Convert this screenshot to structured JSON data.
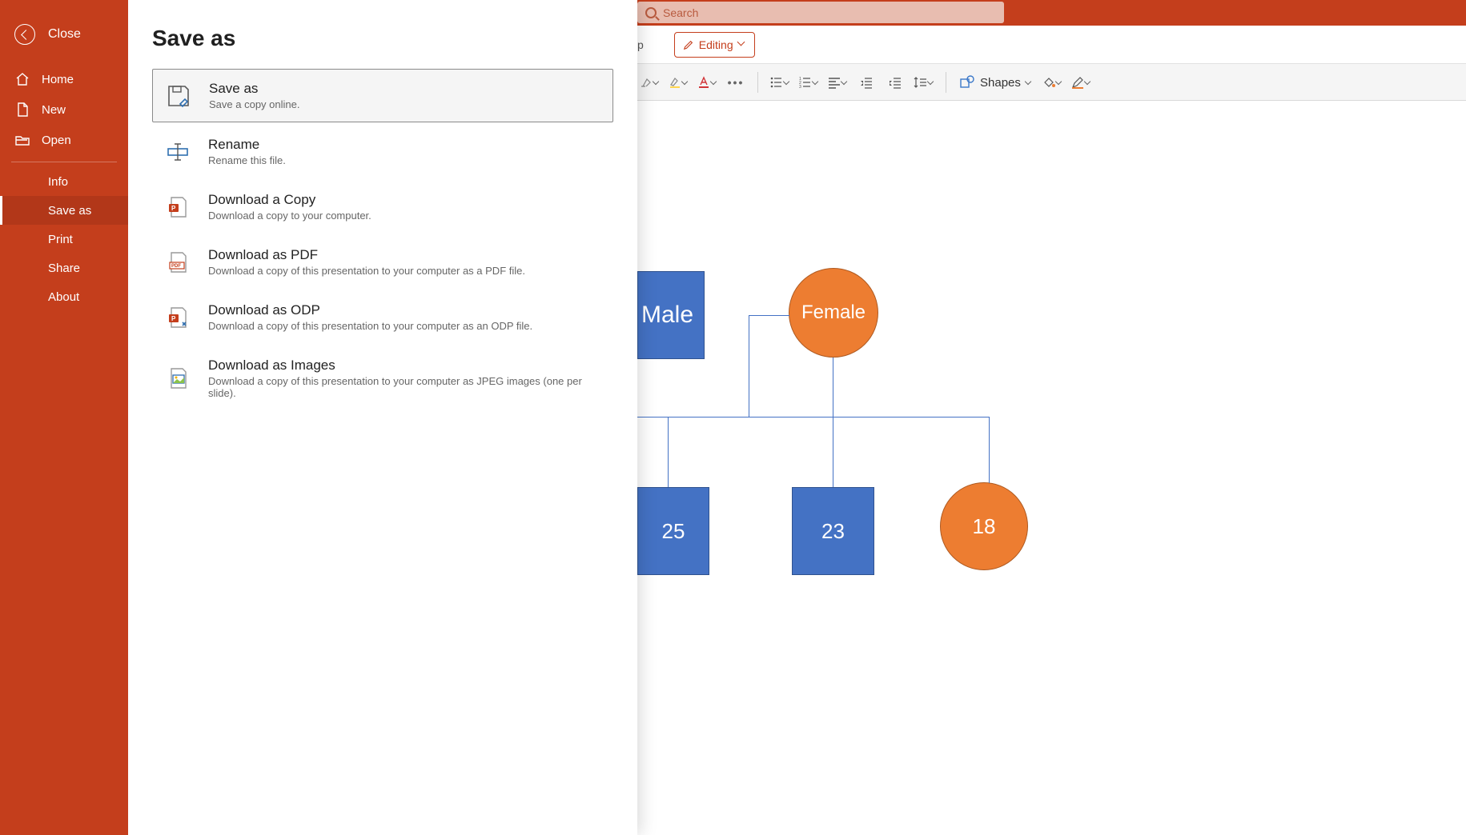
{
  "search": {
    "placeholder": "Search"
  },
  "ribbon": {
    "stub_letter": "p",
    "editing_label": "Editing",
    "shapes_label": "Shapes"
  },
  "chart_data": {
    "type": "diagram",
    "nodes": [
      {
        "id": "male",
        "label": "Male",
        "shape": "rect",
        "color": "#4472c4"
      },
      {
        "id": "female",
        "label": "Female",
        "shape": "circle",
        "color": "#ed7d31"
      },
      {
        "id": "c25",
        "label": "25",
        "shape": "rect",
        "color": "#4472c4"
      },
      {
        "id": "c23",
        "label": "23",
        "shape": "rect",
        "color": "#4472c4"
      },
      {
        "id": "c18",
        "label": "18",
        "shape": "circle",
        "color": "#ed7d31"
      }
    ],
    "edges": [
      [
        "male",
        "c25"
      ],
      [
        "male",
        "c23"
      ],
      [
        "female",
        "c18"
      ]
    ]
  },
  "backstage": {
    "close": "Close",
    "nav_home": "Home",
    "nav_new": "New",
    "nav_open": "Open",
    "nav_info": "Info",
    "nav_saveas": "Save as",
    "nav_print": "Print",
    "nav_share": "Share",
    "nav_about": "About",
    "title": "Save as",
    "options": {
      "saveas": {
        "title": "Save as",
        "desc": "Save a copy online."
      },
      "rename": {
        "title": "Rename",
        "desc": "Rename this file."
      },
      "copy": {
        "title": "Download a Copy",
        "desc": "Download a copy to your computer."
      },
      "pdf": {
        "title": "Download as PDF",
        "desc": "Download a copy of this presentation to your computer as a PDF file."
      },
      "odp": {
        "title": "Download as ODP",
        "desc": "Download a copy of this presentation to your computer as an ODP file."
      },
      "images": {
        "title": "Download as Images",
        "desc": "Download a copy of this presentation to your computer as JPEG images (one per slide)."
      }
    }
  }
}
